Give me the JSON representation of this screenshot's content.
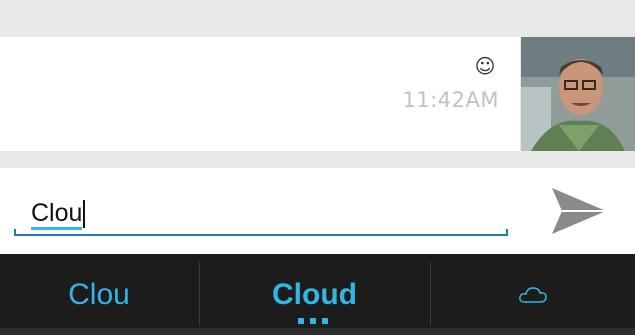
{
  "message": {
    "emoji_icon": "smiley-icon",
    "time": "11:42AM"
  },
  "composer": {
    "input_value": "Clou",
    "send_icon": "send-icon"
  },
  "suggestions": [
    {
      "label": "Clou"
    },
    {
      "label": "Cloud"
    },
    {
      "label": "",
      "icon": "cloud-icon"
    }
  ],
  "colors": {
    "accent": "#33b5e5",
    "suggest_bg": "#1c1c1c",
    "timestamp": "#c2c2c2"
  }
}
